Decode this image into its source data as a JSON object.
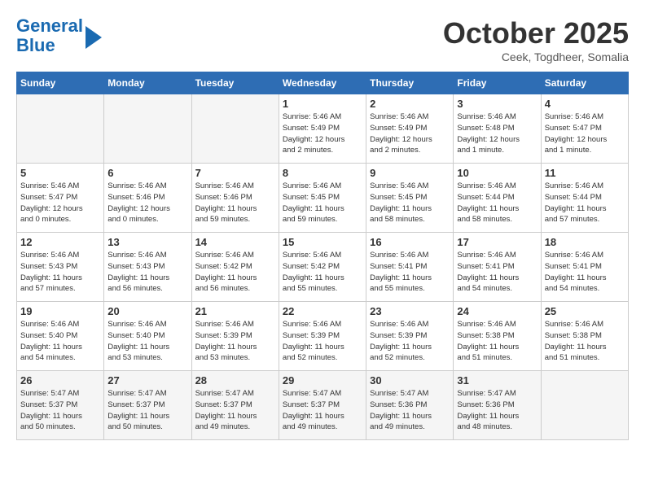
{
  "logo": {
    "line1": "General",
    "line2": "Blue"
  },
  "title": "October 2025",
  "location": "Ceek, Togdheer, Somalia",
  "weekdays": [
    "Sunday",
    "Monday",
    "Tuesday",
    "Wednesday",
    "Thursday",
    "Friday",
    "Saturday"
  ],
  "weeks": [
    [
      {
        "day": "",
        "info": ""
      },
      {
        "day": "",
        "info": ""
      },
      {
        "day": "",
        "info": ""
      },
      {
        "day": "1",
        "info": "Sunrise: 5:46 AM\nSunset: 5:49 PM\nDaylight: 12 hours\nand 2 minutes."
      },
      {
        "day": "2",
        "info": "Sunrise: 5:46 AM\nSunset: 5:49 PM\nDaylight: 12 hours\nand 2 minutes."
      },
      {
        "day": "3",
        "info": "Sunrise: 5:46 AM\nSunset: 5:48 PM\nDaylight: 12 hours\nand 1 minute."
      },
      {
        "day": "4",
        "info": "Sunrise: 5:46 AM\nSunset: 5:47 PM\nDaylight: 12 hours\nand 1 minute."
      }
    ],
    [
      {
        "day": "5",
        "info": "Sunrise: 5:46 AM\nSunset: 5:47 PM\nDaylight: 12 hours\nand 0 minutes."
      },
      {
        "day": "6",
        "info": "Sunrise: 5:46 AM\nSunset: 5:46 PM\nDaylight: 12 hours\nand 0 minutes."
      },
      {
        "day": "7",
        "info": "Sunrise: 5:46 AM\nSunset: 5:46 PM\nDaylight: 11 hours\nand 59 minutes."
      },
      {
        "day": "8",
        "info": "Sunrise: 5:46 AM\nSunset: 5:45 PM\nDaylight: 11 hours\nand 59 minutes."
      },
      {
        "day": "9",
        "info": "Sunrise: 5:46 AM\nSunset: 5:45 PM\nDaylight: 11 hours\nand 58 minutes."
      },
      {
        "day": "10",
        "info": "Sunrise: 5:46 AM\nSunset: 5:44 PM\nDaylight: 11 hours\nand 58 minutes."
      },
      {
        "day": "11",
        "info": "Sunrise: 5:46 AM\nSunset: 5:44 PM\nDaylight: 11 hours\nand 57 minutes."
      }
    ],
    [
      {
        "day": "12",
        "info": "Sunrise: 5:46 AM\nSunset: 5:43 PM\nDaylight: 11 hours\nand 57 minutes."
      },
      {
        "day": "13",
        "info": "Sunrise: 5:46 AM\nSunset: 5:43 PM\nDaylight: 11 hours\nand 56 minutes."
      },
      {
        "day": "14",
        "info": "Sunrise: 5:46 AM\nSunset: 5:42 PM\nDaylight: 11 hours\nand 56 minutes."
      },
      {
        "day": "15",
        "info": "Sunrise: 5:46 AM\nSunset: 5:42 PM\nDaylight: 11 hours\nand 55 minutes."
      },
      {
        "day": "16",
        "info": "Sunrise: 5:46 AM\nSunset: 5:41 PM\nDaylight: 11 hours\nand 55 minutes."
      },
      {
        "day": "17",
        "info": "Sunrise: 5:46 AM\nSunset: 5:41 PM\nDaylight: 11 hours\nand 54 minutes."
      },
      {
        "day": "18",
        "info": "Sunrise: 5:46 AM\nSunset: 5:41 PM\nDaylight: 11 hours\nand 54 minutes."
      }
    ],
    [
      {
        "day": "19",
        "info": "Sunrise: 5:46 AM\nSunset: 5:40 PM\nDaylight: 11 hours\nand 54 minutes."
      },
      {
        "day": "20",
        "info": "Sunrise: 5:46 AM\nSunset: 5:40 PM\nDaylight: 11 hours\nand 53 minutes."
      },
      {
        "day": "21",
        "info": "Sunrise: 5:46 AM\nSunset: 5:39 PM\nDaylight: 11 hours\nand 53 minutes."
      },
      {
        "day": "22",
        "info": "Sunrise: 5:46 AM\nSunset: 5:39 PM\nDaylight: 11 hours\nand 52 minutes."
      },
      {
        "day": "23",
        "info": "Sunrise: 5:46 AM\nSunset: 5:39 PM\nDaylight: 11 hours\nand 52 minutes."
      },
      {
        "day": "24",
        "info": "Sunrise: 5:46 AM\nSunset: 5:38 PM\nDaylight: 11 hours\nand 51 minutes."
      },
      {
        "day": "25",
        "info": "Sunrise: 5:46 AM\nSunset: 5:38 PM\nDaylight: 11 hours\nand 51 minutes."
      }
    ],
    [
      {
        "day": "26",
        "info": "Sunrise: 5:47 AM\nSunset: 5:37 PM\nDaylight: 11 hours\nand 50 minutes."
      },
      {
        "day": "27",
        "info": "Sunrise: 5:47 AM\nSunset: 5:37 PM\nDaylight: 11 hours\nand 50 minutes."
      },
      {
        "day": "28",
        "info": "Sunrise: 5:47 AM\nSunset: 5:37 PM\nDaylight: 11 hours\nand 49 minutes."
      },
      {
        "day": "29",
        "info": "Sunrise: 5:47 AM\nSunset: 5:37 PM\nDaylight: 11 hours\nand 49 minutes."
      },
      {
        "day": "30",
        "info": "Sunrise: 5:47 AM\nSunset: 5:36 PM\nDaylight: 11 hours\nand 49 minutes."
      },
      {
        "day": "31",
        "info": "Sunrise: 5:47 AM\nSunset: 5:36 PM\nDaylight: 11 hours\nand 48 minutes."
      },
      {
        "day": "",
        "info": ""
      }
    ]
  ]
}
